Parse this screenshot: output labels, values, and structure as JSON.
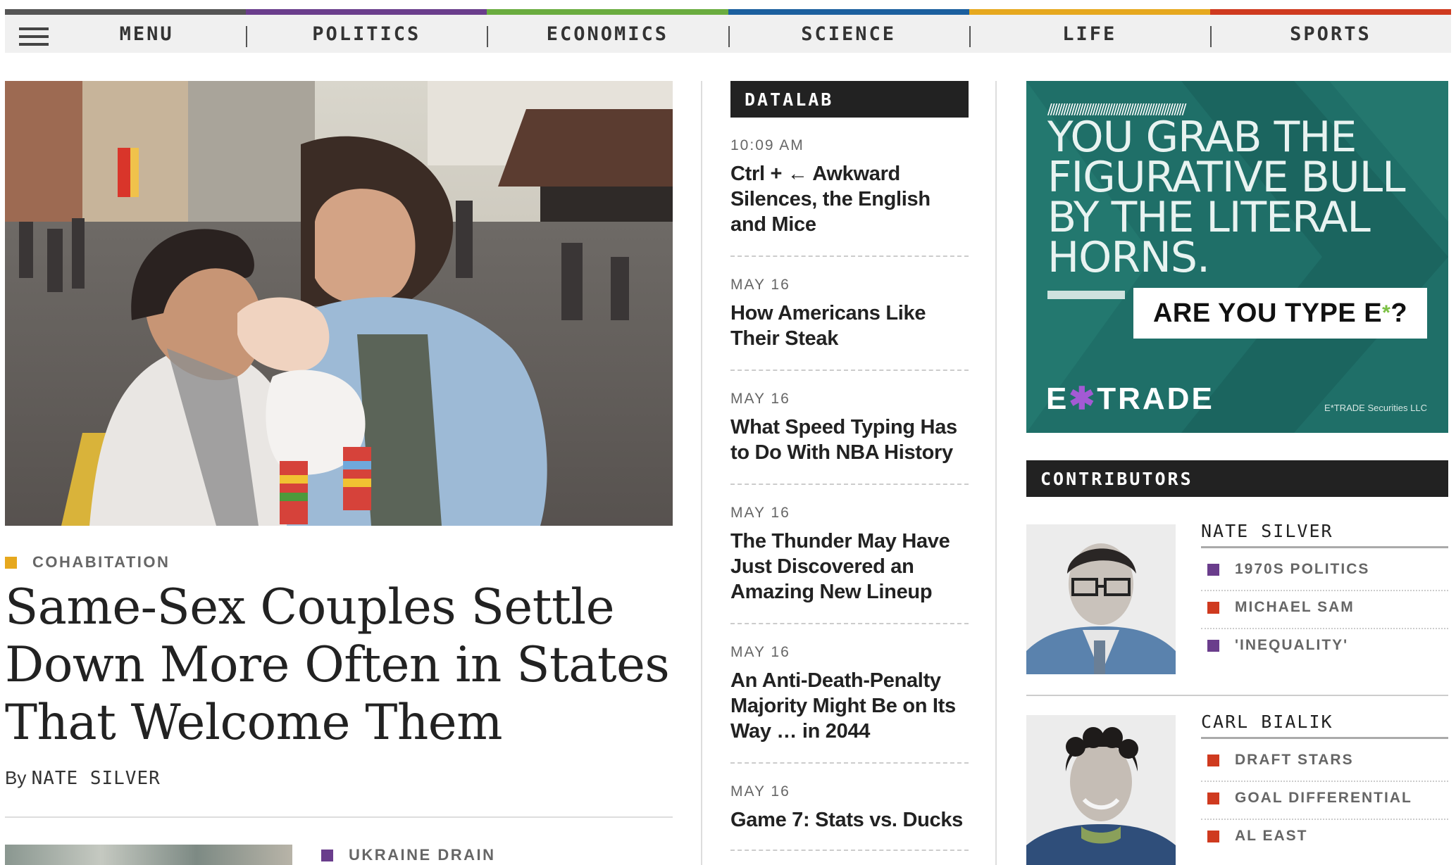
{
  "nav": {
    "items": [
      {
        "label": "MENU",
        "color": "#555555"
      },
      {
        "label": "POLITICS",
        "color": "#6a3d8c"
      },
      {
        "label": "ECONOMICS",
        "color": "#6aac3f"
      },
      {
        "label": "SCIENCE",
        "color": "#1b5f9e"
      },
      {
        "label": "LIFE",
        "color": "#e6a81e"
      },
      {
        "label": "SPORTS",
        "color": "#cf3a1f"
      }
    ],
    "menu_icon": "hamburger-icon"
  },
  "main": {
    "kicker": "COHABITATION",
    "kicker_color": "#e6a81e",
    "headline": "Same-Sex Couples Settle Down More Often in States That Welcome Them",
    "byline_prefix": "By",
    "byline_name": "NATE SILVER",
    "next_kicker": "UKRAINE DRAIN",
    "next_kicker_color": "#6a3d8c"
  },
  "datalab": {
    "label": "DATALAB",
    "stories": [
      {
        "time": "10:09 AM",
        "title": "Ctrl + ← Awkward Silences, the English and Mice"
      },
      {
        "time": "MAY 16",
        "title": "How Americans Like Their Steak"
      },
      {
        "time": "MAY 16",
        "title": "What Speed Typing Has to Do With NBA History"
      },
      {
        "time": "MAY 16",
        "title": "The Thunder May Have Just Discovered an Amazing New Lineup"
      },
      {
        "time": "MAY 16",
        "title": "An Anti-Death-Penalty Majority Might Be on Its Way … in 2044"
      },
      {
        "time": "MAY 16",
        "title": "Game 7: Stats vs. Ducks"
      }
    ]
  },
  "ad": {
    "slashes": "////////////////////////////////////////////////////",
    "headline": "YOU GRAB THE FIGURATIVE BULL BY THE LITERAL HORNS.",
    "cta_prefix": "ARE YOU TYPE E",
    "cta_star": "*",
    "cta_suffix": "?",
    "logo_left": "E",
    "logo_x": "✱",
    "logo_right": "TRADE",
    "legal": "E*TRADE Securities LLC",
    "background": "#1f6f68"
  },
  "contributors": {
    "label": "CONTRIBUTORS",
    "people": [
      {
        "name": "NATE SILVER",
        "topics": [
          {
            "label": "1970S POLITICS",
            "color": "#6a3d8c"
          },
          {
            "label": "MICHAEL SAM",
            "color": "#cf3a1f"
          },
          {
            "label": "'INEQUALITY'",
            "color": "#6a3d8c"
          }
        ]
      },
      {
        "name": "CARL BIALIK",
        "topics": [
          {
            "label": "DRAFT STARS",
            "color": "#cf3a1f"
          },
          {
            "label": "GOAL DIFFERENTIAL",
            "color": "#cf3a1f"
          },
          {
            "label": "AL EAST",
            "color": "#cf3a1f"
          }
        ]
      }
    ]
  }
}
